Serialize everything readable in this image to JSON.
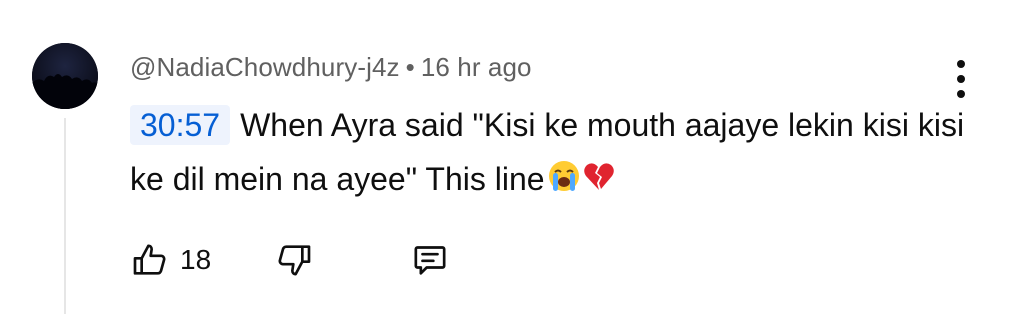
{
  "comment": {
    "author": "@NadiaChowdhury-j4z",
    "separator": "•",
    "time_ago": "16 hr ago",
    "timestamp_link": "30:57",
    "text": "When Ayra said \"Kisi ke mouth aajaye lekin kisi kisi ke dil mein na ayee\" This line",
    "emojis": [
      "loudly-crying-face-emoji",
      "broken-heart-emoji"
    ]
  },
  "actions": {
    "like_count": "18",
    "like_icon": "thumbs-up-icon",
    "dislike_icon": "thumbs-down-icon",
    "reply_icon": "reply-comment-icon"
  },
  "menu_icon": "more-vertical-icon",
  "colors": {
    "timestamp_text": "#065fd4",
    "timestamp_bg": "#eef3fd",
    "meta_text": "#606060",
    "main_text": "#0f0f0f"
  }
}
